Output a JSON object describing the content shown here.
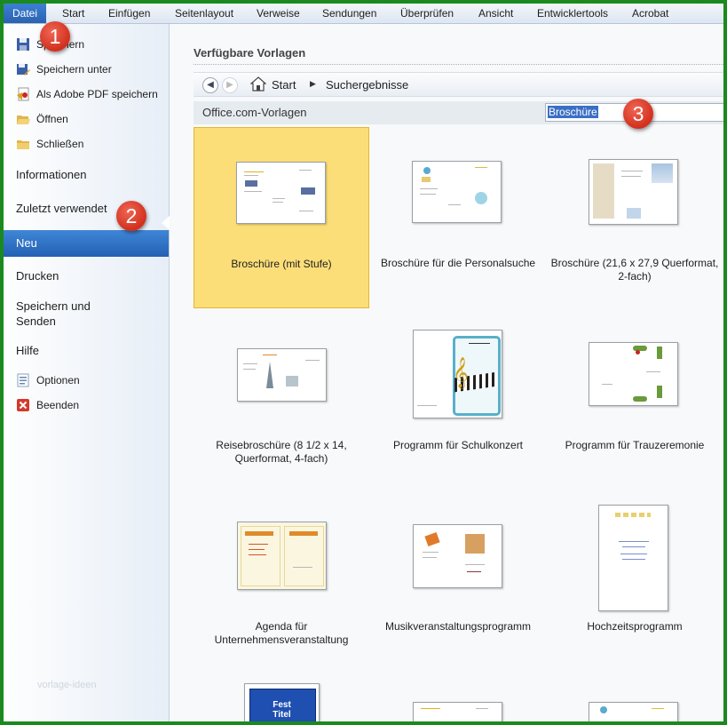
{
  "ribbon": {
    "tabs": [
      "Datei",
      "Start",
      "Einfügen",
      "Seitenlayout",
      "Verweise",
      "Sendungen",
      "Überprüfen",
      "Ansicht",
      "Entwicklertools",
      "Acrobat"
    ]
  },
  "backstage": {
    "small_items": [
      {
        "label": "Speichern",
        "icon": "save-icon"
      },
      {
        "label": "Speichern unter",
        "icon": "save-as-icon"
      },
      {
        "label": "Als Adobe PDF speichern",
        "icon": "pdf-icon"
      },
      {
        "label": "Öffnen",
        "icon": "open-folder-icon"
      },
      {
        "label": "Schließen",
        "icon": "close-folder-icon"
      }
    ],
    "info": "Informationen",
    "recent": "Zuletzt verwendet",
    "new": "Neu",
    "print": "Drucken",
    "send_line1": "Speichern und",
    "send_line2": "Senden",
    "help": "Hilfe",
    "options": "Optionen",
    "exit": "Beenden",
    "watermark": "vorlage-ideen"
  },
  "badges": [
    "1",
    "2",
    "3"
  ],
  "main": {
    "heading": "Verfügbare Vorlagen",
    "breadcrumb": {
      "home": "Start",
      "current": "Suchergebnisse"
    },
    "source": "Office.com-Vorlagen",
    "search_value": "Broschüre",
    "templates": [
      {
        "l1": "Broschüre (mit Stufe)",
        "l2": ""
      },
      {
        "l1": "Broschüre für die Personalsuche",
        "l2": ""
      },
      {
        "l1": "Broschüre (21,6 x 27,9 Querformat,",
        "l2": "2-fach)"
      },
      {
        "l1": "Reisebroschüre (8 1/2 x 14,",
        "l2": "Querformat, 4-fach)"
      },
      {
        "l1": "Programm für Schulkonzert",
        "l2": ""
      },
      {
        "l1": "Programm für Trauzeremonie",
        "l2": ""
      },
      {
        "l1": "Agenda für",
        "l2": "Unternehmensveranstaltung"
      },
      {
        "l1": "Musikveranstaltungsprogramm",
        "l2": ""
      },
      {
        "l1": "Hochzeitsprogramm",
        "l2": ""
      }
    ],
    "fest_thumb": {
      "line1": "Fest",
      "line2": "Titel"
    }
  },
  "colors": {
    "frame": "#1b8a1e",
    "selection": "#fcde79",
    "accent": "#2a62b0",
    "badge": "#d2301d"
  }
}
